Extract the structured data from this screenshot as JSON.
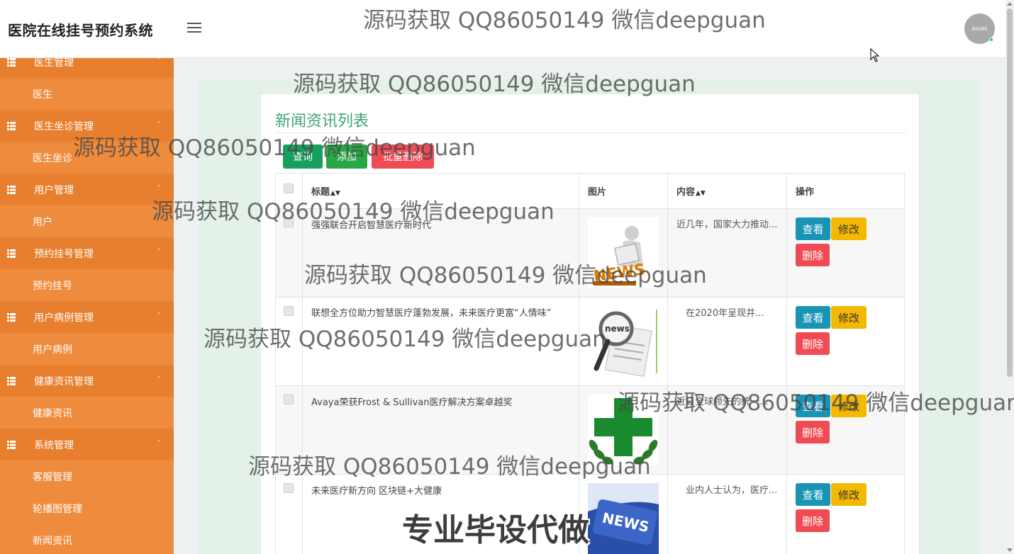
{
  "header": {
    "app_title": "医院在线挂号预约系统",
    "avatar_text": "80x80"
  },
  "sidebar": {
    "groups": [
      {
        "label": "医生管理",
        "items": [
          "医生"
        ]
      },
      {
        "label": "医生坐诊管理",
        "items": [
          "医生坐诊"
        ]
      },
      {
        "label": "用户管理",
        "items": [
          "用户"
        ]
      },
      {
        "label": "预约挂号管理",
        "items": [
          "预约挂号"
        ]
      },
      {
        "label": "用户病例管理",
        "items": [
          "用户病例"
        ]
      },
      {
        "label": "健康资讯管理",
        "items": [
          "健康资讯"
        ]
      },
      {
        "label": "系统管理",
        "items": [
          "客服管理",
          "轮播图管理",
          "新闻资讯"
        ]
      }
    ]
  },
  "main": {
    "title": "新闻资讯列表",
    "buttons": {
      "query": "查询",
      "add": "添加",
      "batch_delete": "批量删除"
    },
    "table": {
      "headers": {
        "title": "标题",
        "image": "图片",
        "content": "内容",
        "actions": "操作"
      },
      "rows": [
        {
          "title": "强强联合开启智慧医疗新时代",
          "image": "news-person-icon",
          "content": "近几年，国家大力推动..."
        },
        {
          "title": "联想全方位助力智慧医疗蓬勃发展，未来医疗更富“人情味”",
          "image": "magnifier-newspaper-icon",
          "content": "　在2020年呈现井..."
        },
        {
          "title": "Avaya荣获Frost & Sullivan医疗解决方案卓越奖",
          "image": "medical-cross-icon",
          "content": "近日全球领先的统一..."
        },
        {
          "title": "未来医疗新方向 区块链+大健康",
          "image": "news-key-icon",
          "content": "　业内人士认为，医疗..."
        }
      ],
      "actions": {
        "view": "查看",
        "edit": "修改",
        "delete": "删除"
      }
    }
  },
  "watermarks": {
    "text": "源码获取 QQ86050149 微信deepguan",
    "big_text": "专业毕设代做"
  },
  "colors": {
    "sidebar": "#ef8b3c",
    "sidebar_group": "#e87f2e",
    "title_green": "#3fa56f",
    "view": "#1a94b5",
    "edit": "#f5b800",
    "delete": "#ef4b55"
  }
}
